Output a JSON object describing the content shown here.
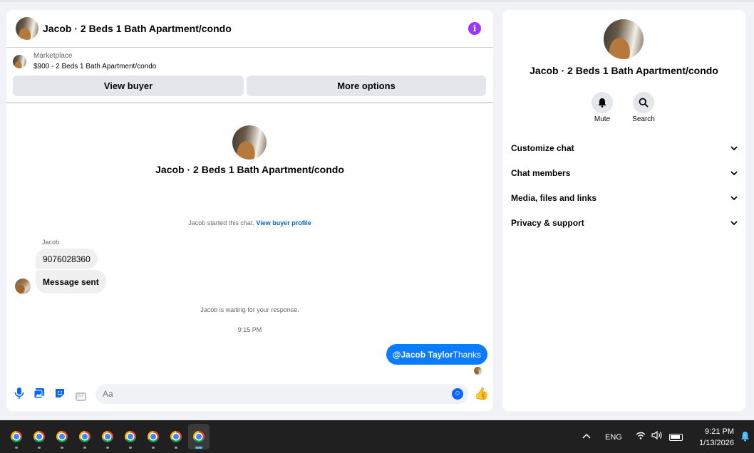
{
  "chat": {
    "header": {
      "title": "Jacob · 2 Beds 1 Bath Apartment/condo",
      "info_icon": "i"
    },
    "marketplace": {
      "label": "Marketplace",
      "item": "$900 - 2 Beds 1 Bath Apartment/condo",
      "view_buyer": "View buyer",
      "more_options": "More options"
    },
    "intro": {
      "name": "Jacob · 2 Beds 1 Bath Apartment/condo"
    },
    "started": {
      "text": "Jacob started this chat.",
      "link": "View buyer profile"
    },
    "sender_name": "Jacob",
    "messages_in": [
      "9076028360",
      "Message sent"
    ],
    "waiting": "Jacob is waiting for your response.",
    "time": "9:15 PM",
    "message_out": {
      "mention": "@Jacob Taylor",
      "text": "Thanks"
    },
    "composer": {
      "placeholder": "Aa",
      "gif_label": "GIF"
    }
  },
  "side": {
    "name": "Jacob · 2 Beds 1 Bath Apartment/condo",
    "actions": {
      "mute": "Mute",
      "search": "Search"
    },
    "sections": [
      "Customize chat",
      "Chat members",
      "Media, files and links",
      "Privacy & support"
    ]
  },
  "taskbar": {
    "app_icons": [
      "chrome-icon",
      "chrome-icon",
      "chrome-icon",
      "chrome-icon",
      "chrome-icon",
      "chrome-icon",
      "chrome-icon",
      "chrome-icon",
      "chrome-icon"
    ],
    "lang": "ENG",
    "time": "9:21 PM",
    "date": "1/13/2026"
  },
  "colors": {
    "accent": "#0866ff",
    "bubble_out": "#0a7cff",
    "info": "#a033ff",
    "bubble_in": "#f0f0f0"
  }
}
